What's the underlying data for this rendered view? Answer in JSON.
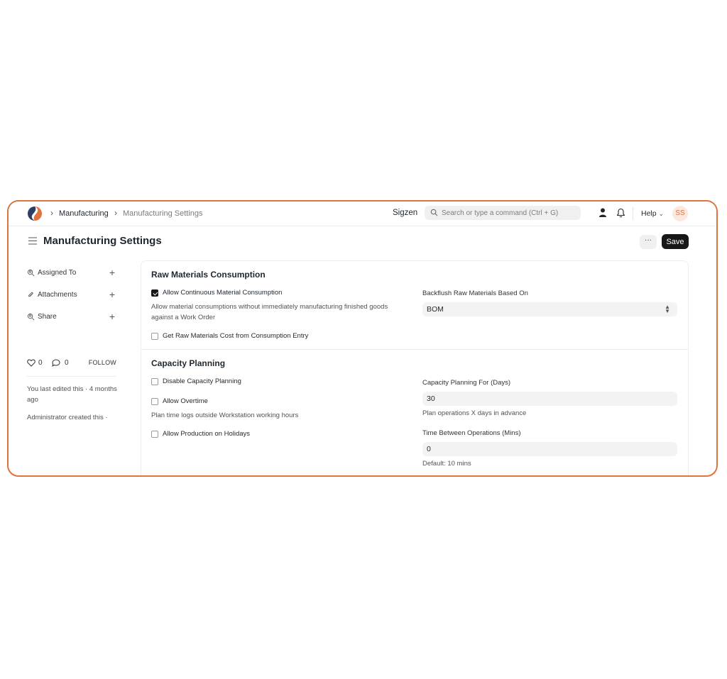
{
  "navbar": {
    "breadcrumbs": [
      "Manufacturing",
      "Manufacturing Settings"
    ],
    "brand": "Sigzen",
    "search_placeholder": "Search or type a command (Ctrl + G)",
    "help_label": "Help",
    "avatar_initials": "SS"
  },
  "page": {
    "title": "Manufacturing Settings",
    "more_label": "···",
    "save_label": "Save"
  },
  "sidebar": {
    "actions": [
      {
        "label": "Assigned To",
        "icon": "assign-icon"
      },
      {
        "label": "Attachments",
        "icon": "paperclip-icon"
      },
      {
        "label": "Share",
        "icon": "share-icon"
      }
    ],
    "likes": "0",
    "comments": "0",
    "follow_label": "FOLLOW",
    "last_edited": "You last edited this · 4 months ago",
    "created": "Administrator created this ·"
  },
  "sections": {
    "raw_materials": {
      "title": "Raw Materials Consumption",
      "allow_continuous": {
        "label": "Allow Continuous Material Consumption",
        "checked": true,
        "description": "Allow material consumptions without immediately manufacturing finished goods against a Work Order"
      },
      "get_cost": {
        "label": "Get Raw Materials Cost from Consumption Entry",
        "checked": false
      },
      "backflush": {
        "label": "Backflush Raw Materials Based On",
        "value": "BOM"
      }
    },
    "capacity": {
      "title": "Capacity Planning",
      "disable": {
        "label": "Disable Capacity Planning",
        "checked": false
      },
      "overtime": {
        "label": "Allow Overtime",
        "checked": false,
        "description": "Plan time logs outside Workstation working hours"
      },
      "holidays": {
        "label": "Allow Production on Holidays",
        "checked": false
      },
      "days": {
        "label": "Capacity Planning For (Days)",
        "value": "30",
        "description": "Plan operations X days in advance"
      },
      "mins": {
        "label": "Time Between Operations (Mins)",
        "value": "0",
        "description": "Default: 10 mins"
      }
    }
  },
  "colors": {
    "frame_border": "#e0733f",
    "save_button": "#171717",
    "avatar_bg": "#fde8de",
    "logo_blue": "#2c3e63",
    "logo_orange": "#e0733f"
  }
}
